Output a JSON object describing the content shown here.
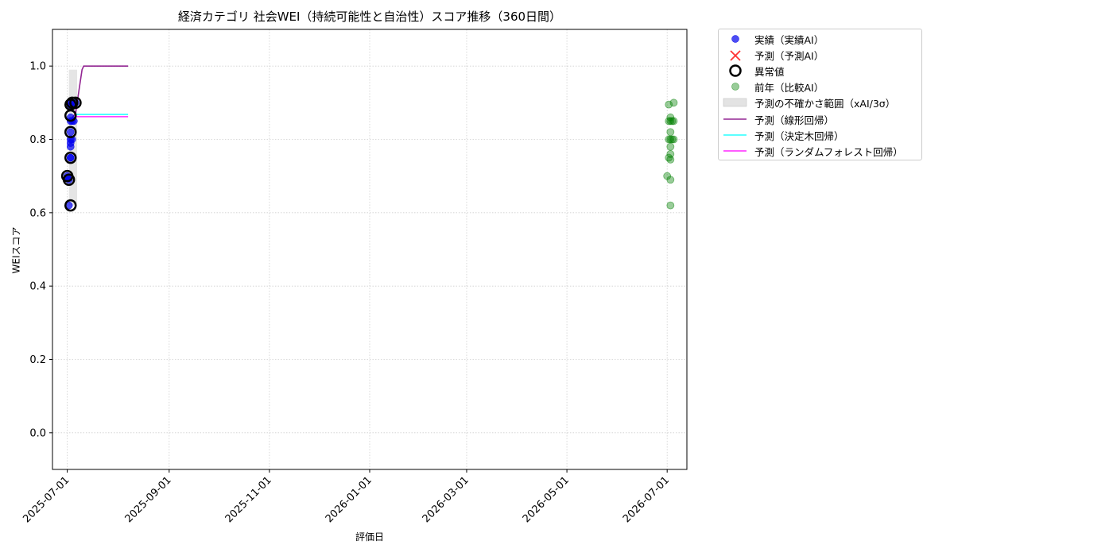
{
  "chart_data": {
    "type": "scatter",
    "title": "経済カテゴリ 社会WEI（持続可能性と自治性）スコア推移（360日間）",
    "xlabel": "評価日",
    "ylabel": "WEIスコア",
    "xlim": [
      "2025-06-22",
      "2026-07-13"
    ],
    "ylim": [
      -0.1,
      1.1
    ],
    "yticks": [
      0.0,
      0.2,
      0.4,
      0.6,
      0.8,
      1.0
    ],
    "ytick_labels": [
      "0.0",
      "0.2",
      "0.4",
      "0.6",
      "0.8",
      "1.0"
    ],
    "xticks": [
      "2025-07-01",
      "2025-09-01",
      "2025-11-01",
      "2026-01-01",
      "2026-03-01",
      "2026-05-01",
      "2026-07-01"
    ],
    "grid": true,
    "legend_placement": "outside-upper-right",
    "series": [
      {
        "name": "実績（実績AI）",
        "kind": "scatter",
        "color": "#0000ee",
        "x": [
          "2025-07-01",
          "2025-07-01",
          "2025-07-02",
          "2025-07-02",
          "2025-07-03",
          "2025-07-03",
          "2025-07-03",
          "2025-07-03",
          "2025-07-03",
          "2025-07-03",
          "2025-07-03",
          "2025-07-03",
          "2025-07-03",
          "2025-07-03",
          "2025-07-04",
          "2025-07-04",
          "2025-07-04",
          "2025-07-05",
          "2025-07-06"
        ],
        "y": [
          0.7,
          0.695,
          0.69,
          0.62,
          0.75,
          0.78,
          0.79,
          0.8,
          0.82,
          0.85,
          0.86,
          0.89,
          0.9,
          0.75,
          0.8,
          0.85,
          0.9,
          0.85,
          0.9
        ]
      },
      {
        "name": "予測（予測AI）",
        "kind": "scatter",
        "color": "#ff0000",
        "x": [],
        "y": []
      },
      {
        "name": "異常値",
        "kind": "scatter",
        "color": "#000000",
        "x": [
          "2025-07-01",
          "2025-07-02",
          "2025-07-03",
          "2025-07-03",
          "2025-07-03",
          "2025-07-03",
          "2025-07-03",
          "2025-07-04",
          "2025-07-06"
        ],
        "y": [
          0.7,
          0.69,
          0.62,
          0.75,
          0.82,
          0.865,
          0.895,
          0.9,
          0.9
        ]
      },
      {
        "name": "前年（比較AI）",
        "kind": "scatter",
        "color": "#008000",
        "x": [
          "2026-07-01",
          "2026-07-02",
          "2026-07-02",
          "2026-07-02",
          "2026-07-02",
          "2026-07-03",
          "2026-07-03",
          "2026-07-03",
          "2026-07-03",
          "2026-07-03",
          "2026-07-03",
          "2026-07-03",
          "2026-07-03",
          "2026-07-03",
          "2026-07-04",
          "2026-07-04",
          "2026-07-05",
          "2026-07-05",
          "2026-07-05"
        ],
        "y": [
          0.7,
          0.75,
          0.8,
          0.85,
          0.895,
          0.62,
          0.69,
          0.745,
          0.76,
          0.78,
          0.8,
          0.82,
          0.85,
          0.86,
          0.8,
          0.85,
          0.85,
          0.9,
          0.8
        ]
      },
      {
        "name": "予測の不確かさ範囲（xAI/3σ）",
        "kind": "band",
        "color": "#cccccc",
        "x": [
          "2025-07-02",
          "2025-07-07"
        ],
        "lower": [
          0.62,
          0.62
        ],
        "upper": [
          0.99,
          0.99
        ]
      },
      {
        "name": "予測（線形回帰）",
        "kind": "line",
        "color": "#800080",
        "x": [
          "2025-07-04",
          "2025-07-06",
          "2025-07-08",
          "2025-07-10",
          "2025-07-11",
          "2025-07-14",
          "2025-08-07"
        ],
        "y": [
          0.86,
          0.87,
          0.93,
          0.99,
          1.0,
          1.0,
          1.0
        ]
      },
      {
        "name": "予測（決定木回帰）",
        "kind": "line",
        "color": "#00ffff",
        "x": [
          "2025-07-06",
          "2025-08-07"
        ],
        "y": [
          0.868,
          0.868
        ]
      },
      {
        "name": "予測（ランダムフォレスト回帰）",
        "kind": "line",
        "color": "#ff00ff",
        "x": [
          "2025-07-06",
          "2025-08-07"
        ],
        "y": [
          0.862,
          0.862
        ]
      }
    ]
  }
}
